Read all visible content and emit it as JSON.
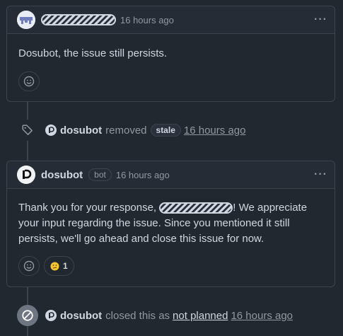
{
  "comment1": {
    "time": "16 hours ago",
    "body": "Dosubot, the issue still persists."
  },
  "event1": {
    "actor": "dosubot",
    "action": "removed",
    "label": "stale",
    "time": "16 hours ago"
  },
  "comment2": {
    "author": "dosubot",
    "badge": "bot",
    "time": "16 hours ago",
    "body_part1": "Thank you for your response, ",
    "body_part2": "! We appreciate your input regarding the issue. Since you mentioned it still persists, we'll go ahead and close this issue for now.",
    "reaction_count": "1"
  },
  "event2": {
    "actor": "dosubot",
    "action": "closed this as",
    "reason": "not planned",
    "time": "16 hours ago"
  },
  "colors": {
    "background": "#212830",
    "border": "#3d444d",
    "text": "#d1d7e0",
    "muted": "#9198a1"
  }
}
